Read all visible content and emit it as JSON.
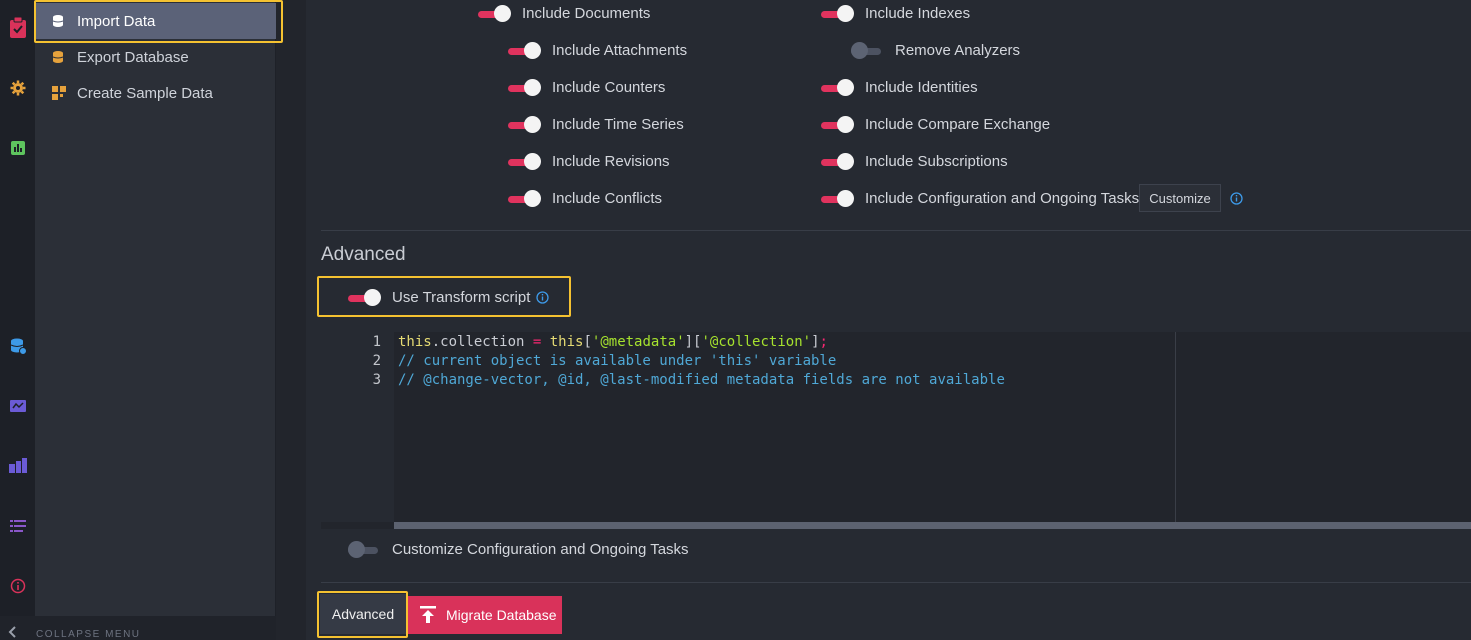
{
  "colors": {
    "accent": "#e0335e",
    "highlight": "#f5c231",
    "info": "#3d9ae8"
  },
  "rail": {
    "icons": [
      "clipboard-check-icon",
      "gear-icon",
      "stats-icon",
      "databases-icon",
      "ongoing-tasks-icon",
      "cluster-icon",
      "list-icon",
      "about-icon"
    ]
  },
  "submenu": {
    "items": [
      {
        "label": "Import Data",
        "icon": "database-import-icon",
        "active": true
      },
      {
        "label": "Export Database",
        "icon": "database-export-icon",
        "active": false
      },
      {
        "label": "Create Sample Data",
        "icon": "sample-data-icon",
        "active": false
      }
    ],
    "collapse_label": "COLLAPSE MENU"
  },
  "toggles": {
    "include_documents": {
      "label": "Include Documents",
      "on": true
    },
    "include_attachments": {
      "label": "Include Attachments",
      "on": true
    },
    "include_counters": {
      "label": "Include Counters",
      "on": true
    },
    "include_time_series": {
      "label": "Include Time Series",
      "on": true
    },
    "include_revisions": {
      "label": "Include Revisions",
      "on": true
    },
    "include_conflicts": {
      "label": "Include Conflicts",
      "on": true
    },
    "include_indexes": {
      "label": "Include Indexes",
      "on": true
    },
    "remove_analyzers": {
      "label": "Remove Analyzers",
      "on": false
    },
    "include_identities": {
      "label": "Include Identities",
      "on": true
    },
    "include_compare_exchange": {
      "label": "Include Compare Exchange",
      "on": true
    },
    "include_subscriptions": {
      "label": "Include Subscriptions",
      "on": true
    },
    "include_configuration": {
      "label": "Include Configuration and Ongoing Tasks",
      "on": true
    },
    "use_transform_script": {
      "label": "Use Transform script",
      "on": true
    },
    "customize_configuration": {
      "label": "Customize Configuration and Ongoing Tasks",
      "on": false
    }
  },
  "customize_button": "Customize",
  "advanced_title": "Advanced",
  "editor": {
    "line_numbers": [
      "1",
      "2",
      "3"
    ],
    "line1": {
      "kw1": "this",
      "dot": ".",
      "prop": "collection",
      "op": " = ",
      "kw2": "this",
      "b1": "[",
      "s1": "'@metadata'",
      "b2": "][",
      "s2": "'@collection'",
      "b3": "]",
      "semi": ";"
    },
    "line2": "// current object is available under 'this' variable",
    "line3": "// @change-vector, @id, @last-modified metadata fields are not available"
  },
  "buttons": {
    "advanced": "Advanced",
    "migrate": "Migrate Database"
  }
}
